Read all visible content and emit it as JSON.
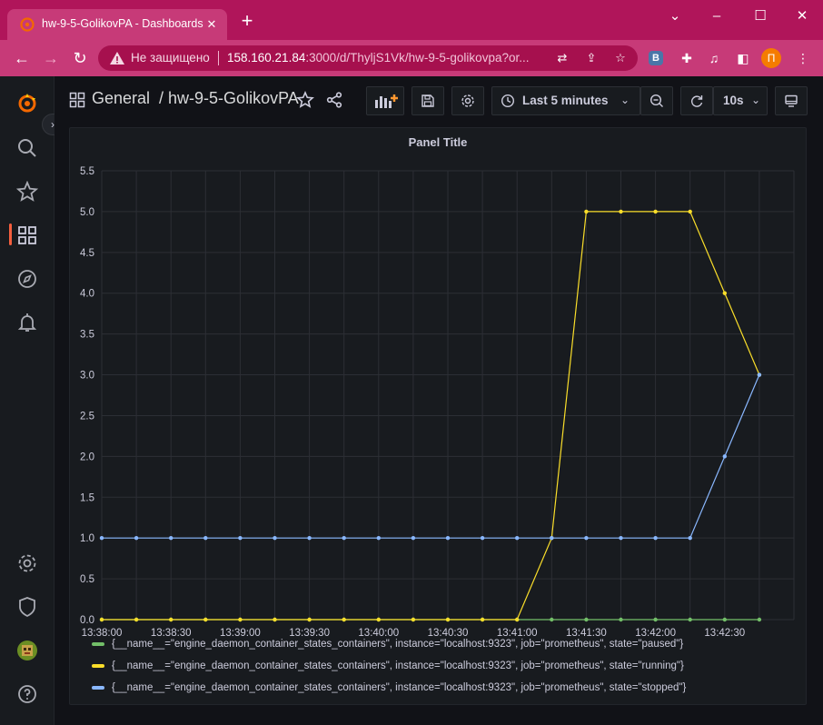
{
  "browser": {
    "tab_title": "hw-9-5-GolikovPA - Dashboards",
    "insecure_label": "Не защищено",
    "url_host": "158.160.21.84",
    "url_rest": ":3000/d/ThyljS1Vk/hw-9-5-golikovpa?or...",
    "profile_initial": "П"
  },
  "header": {
    "breadcrumb": "General  / hw-9-5-GolikovPA",
    "time_range": "Last 5 minutes",
    "refresh_interval": "10s"
  },
  "panel": {
    "title": "Panel Title"
  },
  "legend": [
    {
      "label": "{__name__=\"engine_daemon_container_states_containers\", instance=\"localhost:9323\", job=\"prometheus\", state=\"paused\"}",
      "color": "#73bf69"
    },
    {
      "label": "{__name__=\"engine_daemon_container_states_containers\", instance=\"localhost:9323\", job=\"prometheus\", state=\"running\"}",
      "color": "#fade2a"
    },
    {
      "label": "{__name__=\"engine_daemon_container_states_containers\", instance=\"localhost:9323\", job=\"prometheus\", state=\"stopped\"}",
      "color": "#8ab8ff"
    }
  ],
  "chart_data": {
    "type": "line",
    "title": "Panel Title",
    "ylim": [
      0,
      5.5
    ],
    "y_ticks": [
      "0.0",
      "0.5",
      "1.0",
      "1.5",
      "2.0",
      "2.5",
      "3.0",
      "3.5",
      "4.0",
      "4.5",
      "5.0",
      "5.5"
    ],
    "x_ticks": [
      "13:38:00",
      "13:38:30",
      "13:39:00",
      "13:39:30",
      "13:40:00",
      "13:40:30",
      "13:41:00",
      "13:41:30",
      "13:42:00",
      "13:42:30"
    ],
    "x": [
      "13:38:00",
      "13:38:15",
      "13:38:30",
      "13:38:45",
      "13:39:00",
      "13:39:15",
      "13:39:30",
      "13:39:45",
      "13:40:00",
      "13:40:15",
      "13:40:30",
      "13:40:45",
      "13:41:00",
      "13:41:15",
      "13:41:30",
      "13:41:45",
      "13:42:00",
      "13:42:15",
      "13:42:30",
      "13:42:45"
    ],
    "grid": true,
    "legend_position": "bottom",
    "series": [
      {
        "name": "paused",
        "color": "#73bf69",
        "values": [
          0,
          0,
          0,
          0,
          0,
          0,
          0,
          0,
          0,
          0,
          0,
          0,
          0,
          0,
          0,
          0,
          0,
          0,
          0,
          0
        ]
      },
      {
        "name": "running",
        "color": "#fade2a",
        "values": [
          0,
          0,
          0,
          0,
          0,
          0,
          0,
          0,
          0,
          0,
          0,
          0,
          0,
          1,
          5,
          5,
          5,
          5,
          4,
          3
        ]
      },
      {
        "name": "stopped",
        "color": "#8ab8ff",
        "values": [
          1,
          1,
          1,
          1,
          1,
          1,
          1,
          1,
          1,
          1,
          1,
          1,
          1,
          1,
          1,
          1,
          1,
          1,
          2,
          3
        ]
      }
    ]
  }
}
